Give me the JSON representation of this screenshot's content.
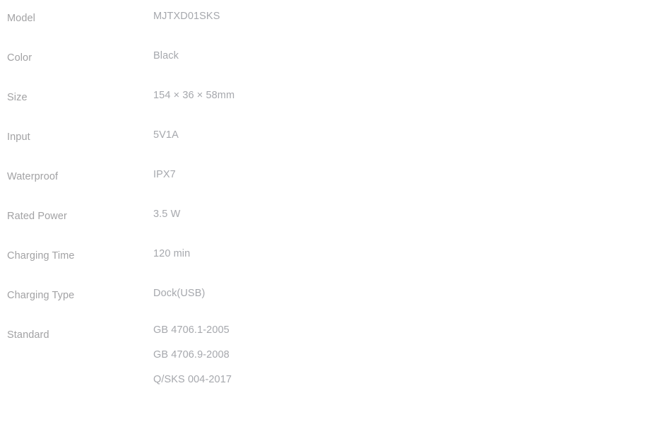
{
  "page": {
    "title": "Product Specification Table",
    "background_color": "#ffffff",
    "label_color": "#a2a2a4",
    "value_color": "#a6a8ad"
  },
  "spec_rows": [
    {
      "label": "Model",
      "values": [
        "MJTXD01SKS"
      ]
    },
    {
      "label": "Color",
      "values": [
        "Black"
      ]
    },
    {
      "label": "Size",
      "values": [
        "154 × 36 × 58mm"
      ]
    },
    {
      "label": "Input",
      "values": [
        "5V1A"
      ]
    },
    {
      "label": "Waterproof",
      "values": [
        "IPX7"
      ]
    },
    {
      "label": "Rated Power",
      "values": [
        "3.5 W"
      ]
    },
    {
      "label": "Charging Time",
      "values": [
        "120 min"
      ]
    },
    {
      "label": "Charging Type",
      "values": [
        "Dock(USB)"
      ]
    },
    {
      "label": "Standard",
      "values": [
        "GB 4706.1-2005",
        "GB 4706.9-2008",
        "Q/SKS 004-2017"
      ]
    }
  ]
}
